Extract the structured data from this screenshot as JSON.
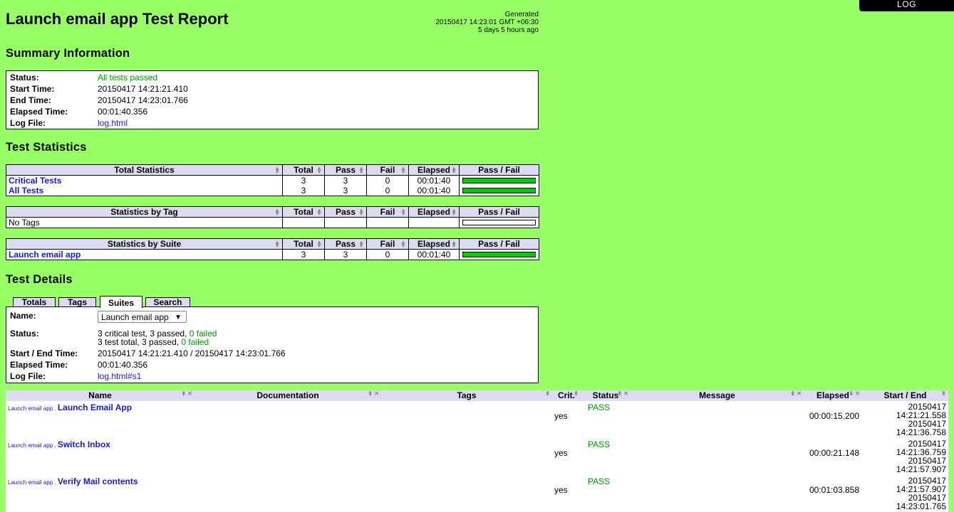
{
  "header": {
    "title": "Launch email app Test Report",
    "generated_label": "Generated",
    "generated_time": "20150417 14:23:01 GMT +06:30",
    "generated_ago": "5 days 5 hours ago",
    "log_button": "LOG"
  },
  "summary": {
    "heading": "Summary Information",
    "rows": [
      {
        "label": "Status:",
        "value": "All tests passed"
      },
      {
        "label": "Start Time:",
        "value": "20150417 14:21:21.410"
      },
      {
        "label": "End Time:",
        "value": "20150417 14:23:01.766"
      },
      {
        "label": "Elapsed Time:",
        "value": "00:01:40.356"
      },
      {
        "label": "Log File:",
        "value": "log.html"
      }
    ]
  },
  "statistics": {
    "heading": "Test Statistics",
    "columns": [
      "Total",
      "Pass",
      "Fail",
      "Elapsed",
      "Pass / Fail"
    ],
    "total": {
      "header": "Total Statistics",
      "rows": [
        {
          "name": "Critical Tests",
          "total": "3",
          "pass": "3",
          "fail": "0",
          "elapsed": "00:01:40",
          "pass_ratio": 1
        },
        {
          "name": "All Tests",
          "total": "3",
          "pass": "3",
          "fail": "0",
          "elapsed": "00:01:40",
          "pass_ratio": 1
        }
      ]
    },
    "tag": {
      "header": "Statistics by Tag",
      "rows": [
        {
          "name": "No Tags"
        }
      ]
    },
    "suite": {
      "header": "Statistics by Suite",
      "rows": [
        {
          "name": "Launch email app",
          "total": "3",
          "pass": "3",
          "fail": "0",
          "elapsed": "00:01:40",
          "pass_ratio": 1
        }
      ]
    }
  },
  "details": {
    "heading": "Test Details",
    "tabs": [
      "Totals",
      "Tags",
      "Suites",
      "Search"
    ],
    "active_tab": "Suites",
    "name_label": "Name:",
    "name_select": "Launch email app",
    "status_label": "Status:",
    "status_line1_prefix": "3 critical test, 3 passed, ",
    "status_line1_failed": "0 failed",
    "status_line2_prefix": "3 test total, 3 passed, ",
    "status_line2_failed": "0 failed",
    "startend_label": "Start / End Time:",
    "startend_value": "20150417 14:21:21.410 / 20150417 14:23:01.766",
    "elapsed_label": "Elapsed Time:",
    "elapsed_value": "00:01:40.356",
    "logfile_label": "Log File:",
    "logfile_value": "log.html#s1"
  },
  "tests_table": {
    "columns": {
      "name": "Name",
      "documentation": "Documentation",
      "tags": "Tags",
      "crit": "Crit.",
      "status": "Status",
      "message": "Message",
      "elapsed": "Elapsed",
      "start_end": "Start / End"
    },
    "rows": [
      {
        "prefix": "Launch email app . ",
        "name": "Launch Email App",
        "crit": "yes",
        "status": "PASS",
        "elapsed": "00:00:15.200",
        "start": "20150417 14:21:21.558",
        "end": "20150417 14:21:36.758"
      },
      {
        "prefix": "Launch email app . ",
        "name": "Switch Inbox",
        "crit": "yes",
        "status": "PASS",
        "elapsed": "00:00:21.148",
        "start": "20150417 14:21:36.759",
        "end": "20150417 14:21:57.907"
      },
      {
        "prefix": "Launch email app . ",
        "name": "Verify Mail contents",
        "crit": "yes",
        "status": "PASS",
        "elapsed": "00:01:03.858",
        "start": "20150417 14:21:57.907",
        "end": "20150417 14:23:01.765"
      }
    ]
  },
  "colors": {
    "background": "#99ff66",
    "pass_green": "#00cc00",
    "link_blue": "#1a1acc",
    "header_bg": "#dcdcf0"
  }
}
